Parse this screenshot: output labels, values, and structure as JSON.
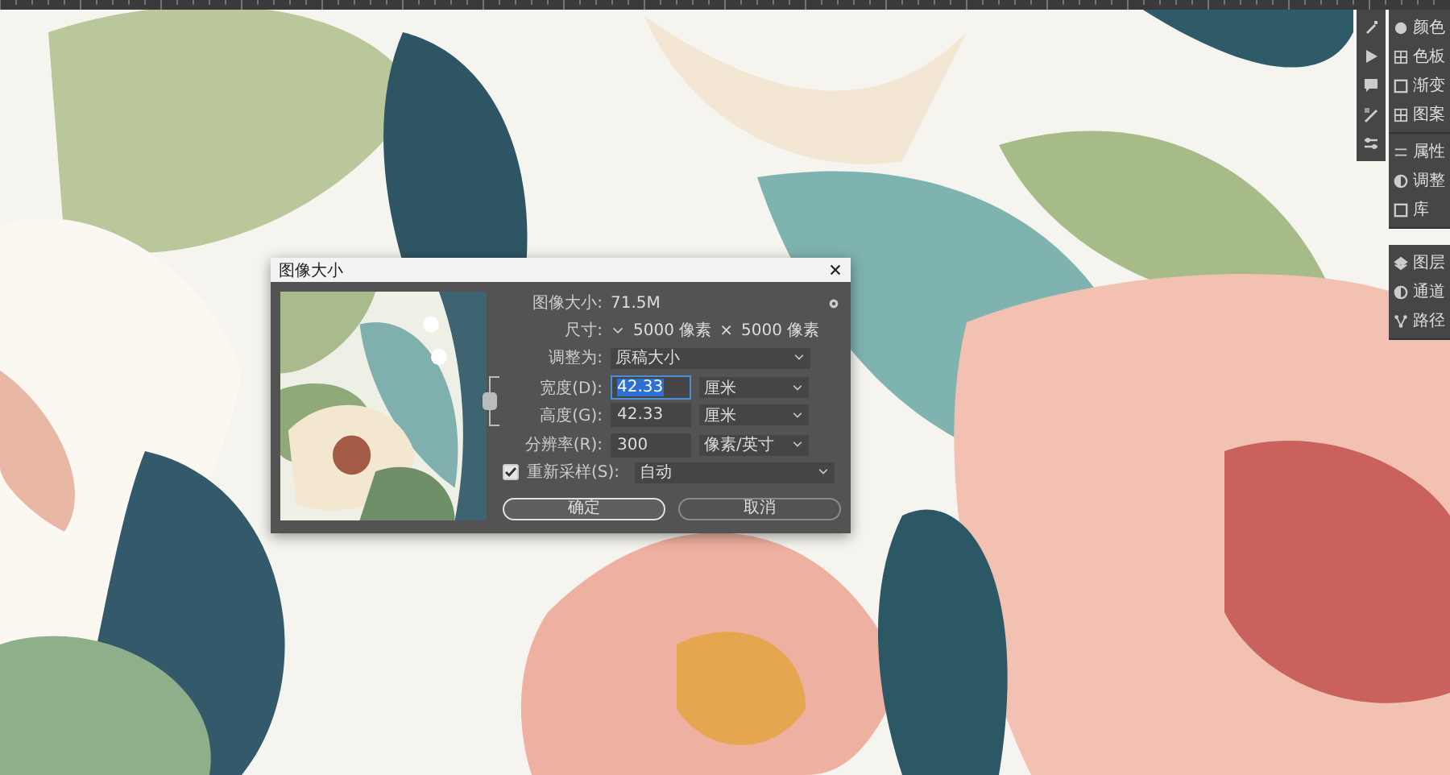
{
  "dialog": {
    "title": "图像大小",
    "image_size": {
      "label": "图像大小:",
      "value": "71.5M"
    },
    "dimensions": {
      "label": "尺寸:",
      "width": "5000 像素",
      "separator": "×",
      "height": "5000 像素"
    },
    "fit_to": {
      "label": "调整为:",
      "value": "原稿大小"
    },
    "constrain_linked": true,
    "fields": [
      {
        "label": "宽度(D):",
        "value": "42.33",
        "selected": true,
        "unit": "厘米"
      },
      {
        "label": "高度(G):",
        "value": "42.33",
        "selected": false,
        "unit": "厘米"
      },
      {
        "label": "分辨率(R):",
        "value": "300",
        "selected": false,
        "unit": "像素/英寸"
      }
    ],
    "resample": {
      "label": "重新采样(S):",
      "checked": true,
      "value": "自动"
    },
    "buttons": [
      {
        "label": "确定",
        "primary": true
      },
      {
        "label": "取消",
        "primary": false
      }
    ]
  },
  "panels": [
    {
      "items": [
        {
          "label": "颜色"
        },
        {
          "label": "色板"
        },
        {
          "label": "渐变"
        },
        {
          "label": "图案"
        }
      ]
    },
    {
      "items": [
        {
          "label": "属性"
        },
        {
          "label": "调整"
        },
        {
          "label": "库"
        }
      ]
    },
    {
      "items": [
        {
          "label": "图层"
        },
        {
          "label": "通道"
        },
        {
          "label": "路径"
        }
      ]
    }
  ]
}
